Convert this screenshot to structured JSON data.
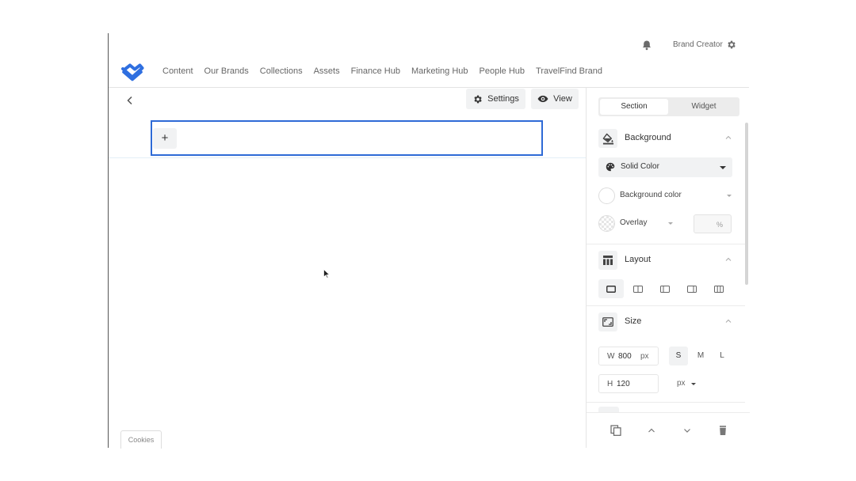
{
  "header": {
    "user_name": "Brand Creator",
    "nav_items": [
      "Content",
      "Our Brands",
      "Collections",
      "Assets",
      "Finance Hub",
      "Marketing Hub",
      "People Hub",
      "TravelFind Brand"
    ]
  },
  "toolbar": {
    "settings_label": "Settings",
    "view_label": "View"
  },
  "canvas": {
    "add_label": "+"
  },
  "cookies_label": "Cookies",
  "panel": {
    "tabs": [
      "Section",
      "Widget"
    ],
    "background": {
      "title": "Background",
      "fill_type": "Solid Color",
      "color_label": "Background color",
      "overlay_label": "Overlay",
      "overlay_unit": "%"
    },
    "layout": {
      "title": "Layout"
    },
    "size": {
      "title": "Size",
      "width_prefix": "W",
      "width_value": "800",
      "width_unit": "px",
      "height_prefix": "H",
      "height_value": "120",
      "height_unit": "px",
      "presets": [
        "S",
        "M",
        "L"
      ]
    }
  },
  "colors": {
    "accent": "#2e6ad6",
    "logo": "#2f6fe0"
  }
}
